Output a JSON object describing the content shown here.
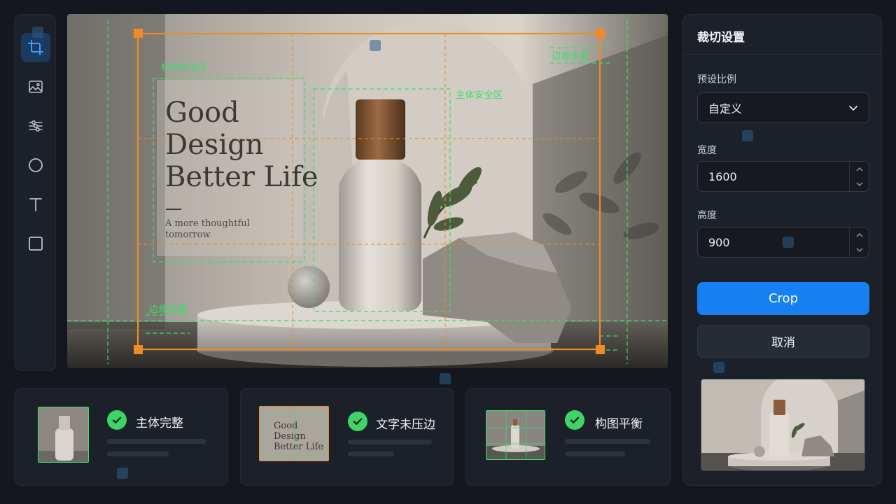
{
  "canvas": {
    "poster": {
      "headline_lines": [
        "Good",
        "Design",
        "Better Life"
      ],
      "subline_lines": [
        "A more thoughtful",
        "tomorrow"
      ]
    },
    "guide_labels": {
      "title_safe": "标题安全区",
      "subject_safe": "主体安全区",
      "edge_margin_top": "边缘余量",
      "edge_margin_bottom": "边缘余量"
    },
    "colors": {
      "crop_frame": "#f08a24",
      "safe_guides": "#37e06a"
    }
  },
  "toolbar": {
    "tools": [
      {
        "icon": "crop-icon",
        "active": true
      },
      {
        "icon": "image-icon",
        "active": false
      },
      {
        "icon": "sliders-icon",
        "active": false
      },
      {
        "icon": "circle-icon",
        "active": false
      },
      {
        "icon": "text-icon",
        "active": false
      },
      {
        "icon": "rectangle-icon",
        "active": false
      }
    ]
  },
  "panel": {
    "title": "裁切设置",
    "preset_label": "预设比例",
    "preset_value": "自定义",
    "width_label": "宽度",
    "width_value": "1600",
    "height_label": "高度",
    "height_value": "900",
    "crop_label": "Crop",
    "cancel_label": "取消",
    "accent": "#1680f2"
  },
  "checks": [
    {
      "label": "主体完整",
      "passed": true
    },
    {
      "label": "文字未压边",
      "passed": true,
      "thumb_text": [
        "Good",
        "Design",
        "Better Life"
      ]
    },
    {
      "label": "构图平衡",
      "passed": true
    }
  ]
}
